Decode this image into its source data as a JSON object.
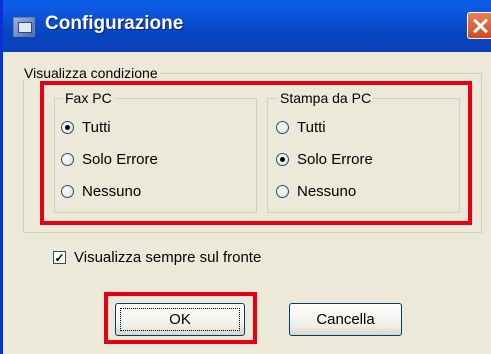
{
  "window": {
    "title": "Configurazione"
  },
  "display_condition": {
    "label": "Visualizza condizione",
    "fax_pc": {
      "label": "Fax PC",
      "options": [
        "Tutti",
        "Solo Errore",
        "Nessuno"
      ],
      "selected": "Tutti"
    },
    "print_pc": {
      "label": "Stampa da PC",
      "options": [
        "Tutti",
        "Solo Errore",
        "Nessuno"
      ],
      "selected": "Solo Errore"
    }
  },
  "always_on_top": {
    "label": "Visualizza sempre sul fronte",
    "checked": true
  },
  "buttons": {
    "ok": "OK",
    "cancel": "Cancella"
  },
  "colors": {
    "titlebar": "#0a5ee8",
    "highlight": "#e60012",
    "dialog_bg": "#ece9d8"
  }
}
